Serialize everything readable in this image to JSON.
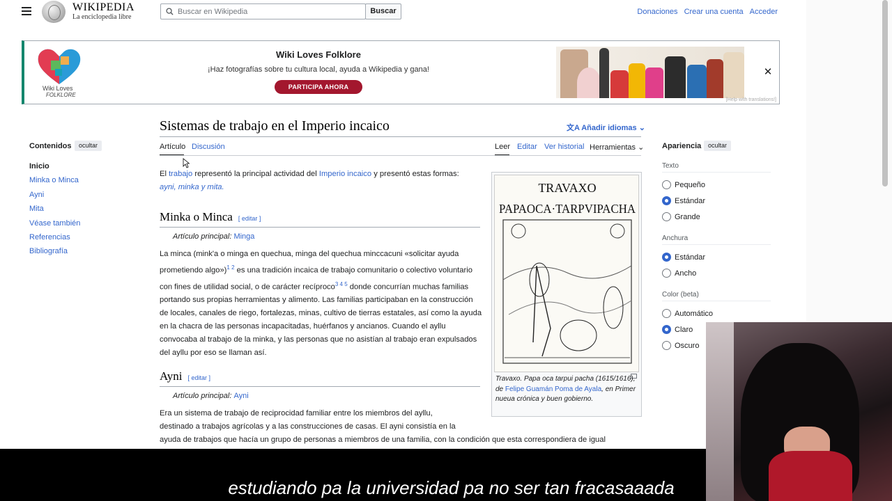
{
  "header": {
    "wordmark": "WIKIPEDIA",
    "tagline": "La enciclopedia libre",
    "search_placeholder": "Buscar en Wikipedia",
    "search_button": "Buscar",
    "links": [
      "Donaciones",
      "Crear una cuenta",
      "Acceder"
    ]
  },
  "banner": {
    "logo_line1": "Wiki Loves",
    "logo_line2": "FOLKLORE",
    "title": "Wiki Loves Folklore",
    "subtitle": "¡Haz fotografías sobre tu cultura local, ayuda a Wikipedia y gana!",
    "cta": "PARTICIPA AHORA",
    "help": "[Help with translations!]",
    "close_icon": "close-icon"
  },
  "page": {
    "title": "Sistemas de trabajo en el Imperio incaico",
    "languages": "Añadir idiomas",
    "tabs_left": [
      "Artículo",
      "Discusión"
    ],
    "tabs_right": [
      "Leer",
      "Editar",
      "Ver historial",
      "Herramientas"
    ]
  },
  "toc": {
    "heading": "Contenidos",
    "hide": "ocultar",
    "items": [
      "Inicio",
      "Minka o Minca",
      "Ayni",
      "Mita",
      "Véase también",
      "Referencias",
      "Bibliografía"
    ]
  },
  "article": {
    "intro_a": "El ",
    "intro_link1": "trabajo",
    "intro_b": " representó la principal actividad del ",
    "intro_link2": "Imperio incaico",
    "intro_c": " y presentó estas formas:",
    "intro_list": "ayni, minka y mita.",
    "s1_title": "Minka o Minca",
    "edit": "[ editar ]",
    "s1_main_label": "Artículo principal:",
    "s1_main_link": "Minga",
    "s1_p": "La minca (mink'a o minga en quechua, minga del quechua minccacuni «solicitar ayuda prometiendo algo»)",
    "s1_p_refs1": "1 2",
    "s1_p2": " es una tradición incaica de trabajo comunitario o colectivo voluntario con fines de utilidad social, o de carácter recíproco",
    "s1_p_refs2": "3 4 5",
    "s1_p3": " donde concurrían muchas familias portando sus propias herramientas y alimento. Las familias participaban en la construcción de locales, canales de riego, fortalezas, minas, cultivo de tierras estatales, así como la ayuda en la chacra de las personas incapacitadas, huérfanos y ancianos. Cuando el ayllu convocaba al trabajo de la minka, y las personas que no asistían al trabajo eran expulsados del ayllu por eso se llaman así.",
    "s2_title": "Ayni",
    "s2_main_label": "Artículo principal:",
    "s2_main_link": "Ayni",
    "s2_p1": "Era un sistema de trabajo de reciprocidad familiar entre los miembros del ayllu,",
    "s2_p2": "destinado a trabajos agrícolas y a las construcciones de casas. El ayni consistía en la",
    "s2_p3": "ayuda de trabajos que hacía un grupo de personas a miembros de una familia, con la condición que esta correspondiera de igual"
  },
  "figure": {
    "img_title1": "TRAVAXO",
    "img_title2": "PAPAOCA·TARPVIPACHA",
    "caption_a": "Travaxo. Papa oca tarpui pacha (1615/1616), de ",
    "caption_link": "Felipe Guamán Poma de Ayala",
    "caption_b": ", en Primer nueua crónica y buen gobierno."
  },
  "appearance": {
    "heading": "Apariencia",
    "hide": "ocultar",
    "text_label": "Texto",
    "text_options": [
      "Pequeño",
      "Estándar",
      "Grande"
    ],
    "text_selected": "Estándar",
    "width_label": "Anchura",
    "width_options": [
      "Estándar",
      "Ancho"
    ],
    "width_selected": "Estándar",
    "color_label": "Color (beta)",
    "color_options": [
      "Automático",
      "Claro",
      "Oscuro"
    ],
    "color_selected": "Claro"
  },
  "subtitle": "estudiando pa la universidad pa no ser tan fracasaaada",
  "colors": {
    "link": "#3366cc",
    "cta": "#a3172e",
    "banner_accent": "#14866d"
  }
}
